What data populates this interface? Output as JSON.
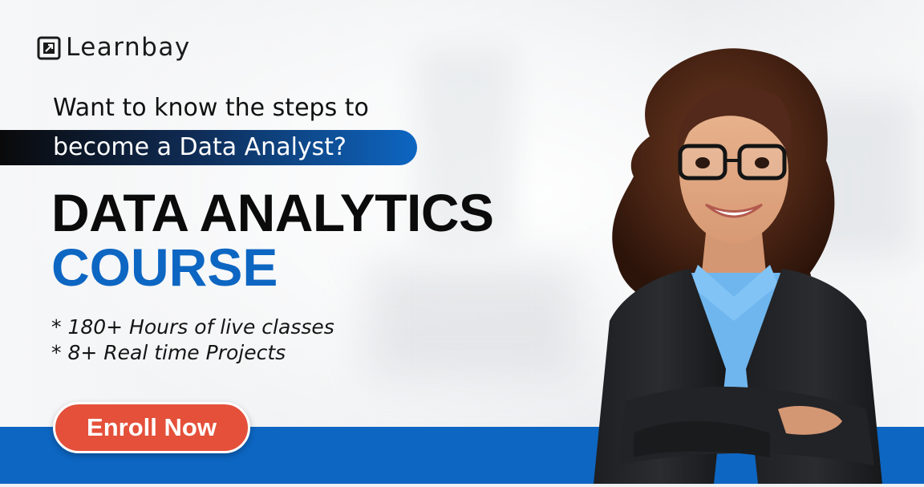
{
  "brand": {
    "name": "Learnbay",
    "logo_icon": "learnbay-logo-icon"
  },
  "tagline": {
    "line1": "Want to know the steps to",
    "line2": "become a Data Analyst?"
  },
  "headline": {
    "line1": "DATA ANALYTICS",
    "line2": "COURSE"
  },
  "features": [
    "* 180+ Hours of live classes",
    "* 8+ Real time Projects"
  ],
  "cta": {
    "label": "Enroll Now"
  },
  "colors": {
    "accent_blue": "#0d66c2",
    "cta_red": "#e4503a",
    "text_dark": "#0b0b0b"
  },
  "image": {
    "subject": "smiling-woman-in-glasses-and-suit-icon"
  }
}
